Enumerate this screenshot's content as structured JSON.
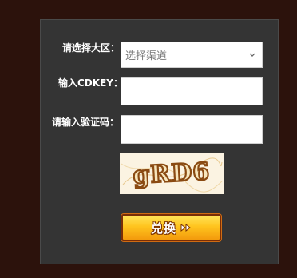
{
  "form": {
    "region_label": "请选择大区：",
    "cdkey_label": "输入CDKEY：",
    "captcha_label": "请输入验证码：",
    "region_select": {
      "selected": "选择渠道",
      "icon": "chevron-down-icon"
    },
    "cdkey_input": {
      "value": "",
      "placeholder": ""
    },
    "captcha_input": {
      "value": "",
      "placeholder": ""
    },
    "captcha_image": {
      "text": "gRD6"
    },
    "redeem_button": {
      "label": "兑换",
      "icon": "double-chevron-right-icon",
      "color": "#ffc41e"
    }
  },
  "colors": {
    "page_background": "#2c120c",
    "panel_background": "#343434",
    "label_text": "#ffffff"
  }
}
